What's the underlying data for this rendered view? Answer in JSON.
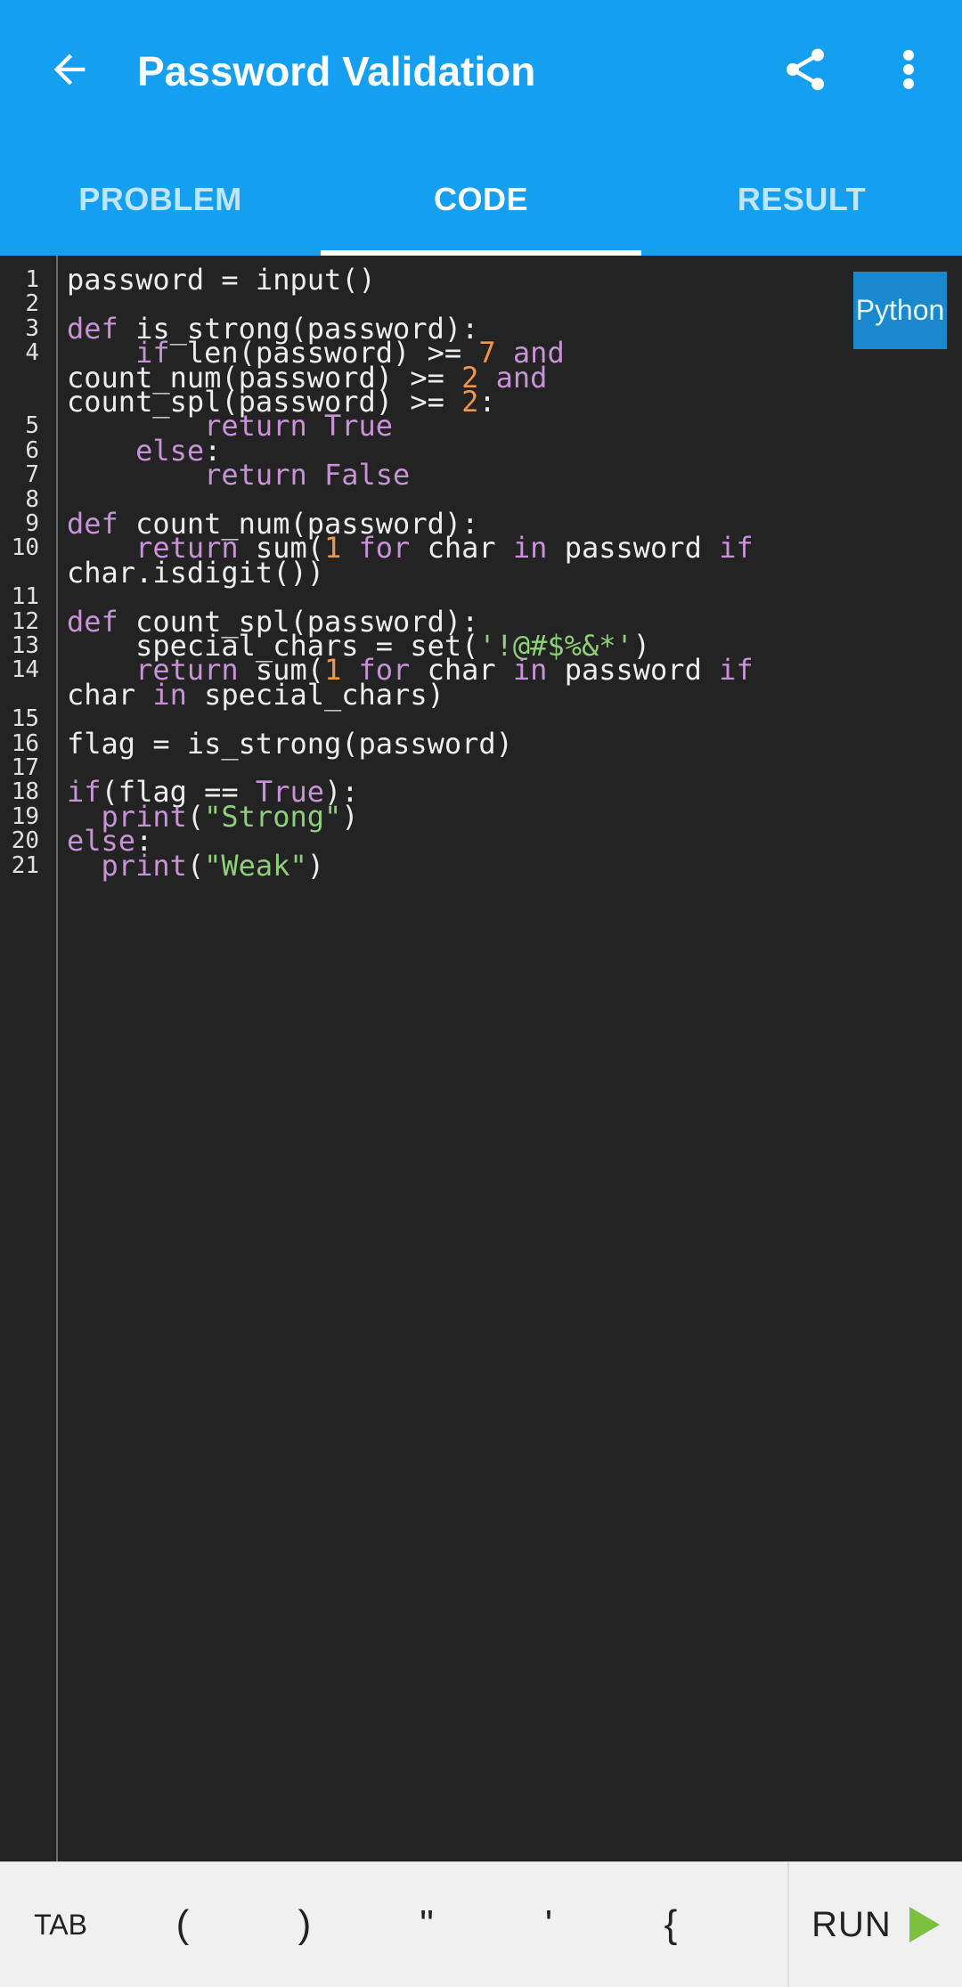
{
  "app_bar": {
    "title": "Password Validation",
    "icons": {
      "back": "back-arrow-icon",
      "share": "share-icon",
      "more": "more-vert-icon"
    },
    "color": "#159ff0"
  },
  "tabs": [
    {
      "label": "PROBLEM",
      "active": false
    },
    {
      "label": "CODE",
      "active": true
    },
    {
      "label": "RESULT",
      "active": false
    }
  ],
  "editor": {
    "language": "Python",
    "colors": {
      "keyword": "#c792d6",
      "number": "#f0964a",
      "string": "#8fce7a",
      "text": "#ededed"
    },
    "lines": [
      {
        "n": "1",
        "segments": [
          {
            "t": "password = input()"
          }
        ]
      },
      {
        "n": "2",
        "segments": [
          {
            "t": ""
          }
        ]
      },
      {
        "n": "3",
        "segments": [
          {
            "t": "def",
            "k": "kw"
          },
          {
            "t": " is_strong(password):"
          }
        ]
      },
      {
        "n": "4",
        "segments": [
          {
            "t": "    "
          },
          {
            "t": "if",
            "k": "kw"
          },
          {
            "t": " len(password) >= "
          },
          {
            "t": "7",
            "k": "num"
          },
          {
            "t": " "
          },
          {
            "t": "and",
            "k": "kw"
          }
        ]
      },
      {
        "n": "",
        "segments": [
          {
            "t": "count_num(password) >= "
          },
          {
            "t": "2",
            "k": "num"
          },
          {
            "t": " "
          },
          {
            "t": "and",
            "k": "kw"
          }
        ]
      },
      {
        "n": "",
        "segments": [
          {
            "t": "count_spl(password) >= "
          },
          {
            "t": "2",
            "k": "num"
          },
          {
            "t": ":"
          }
        ]
      },
      {
        "n": "5",
        "segments": [
          {
            "t": "        "
          },
          {
            "t": "return",
            "k": "kw"
          },
          {
            "t": " "
          },
          {
            "t": "True",
            "k": "kw"
          }
        ]
      },
      {
        "n": "6",
        "segments": [
          {
            "t": "    "
          },
          {
            "t": "else",
            "k": "kw"
          },
          {
            "t": ":"
          }
        ]
      },
      {
        "n": "7",
        "segments": [
          {
            "t": "        "
          },
          {
            "t": "return",
            "k": "kw"
          },
          {
            "t": " "
          },
          {
            "t": "False",
            "k": "kw"
          }
        ]
      },
      {
        "n": "8",
        "segments": [
          {
            "t": ""
          }
        ]
      },
      {
        "n": "9",
        "segments": [
          {
            "t": "def",
            "k": "kw"
          },
          {
            "t": " count_num(password):"
          }
        ]
      },
      {
        "n": "10",
        "segments": [
          {
            "t": "    "
          },
          {
            "t": "return",
            "k": "kw"
          },
          {
            "t": " sum("
          },
          {
            "t": "1",
            "k": "num"
          },
          {
            "t": " "
          },
          {
            "t": "for",
            "k": "kw"
          },
          {
            "t": " char "
          },
          {
            "t": "in",
            "k": "kw"
          },
          {
            "t": " password "
          },
          {
            "t": "if",
            "k": "kw"
          }
        ]
      },
      {
        "n": "",
        "segments": [
          {
            "t": "char.isdigit())"
          }
        ]
      },
      {
        "n": "11",
        "segments": [
          {
            "t": ""
          }
        ]
      },
      {
        "n": "12",
        "segments": [
          {
            "t": "def",
            "k": "kw"
          },
          {
            "t": " count_spl(password):"
          }
        ]
      },
      {
        "n": "13",
        "segments": [
          {
            "t": "    special_chars = set("
          },
          {
            "t": "'!@#$%&*'",
            "k": "str"
          },
          {
            "t": ")"
          }
        ]
      },
      {
        "n": "14",
        "segments": [
          {
            "t": "    "
          },
          {
            "t": "return",
            "k": "kw"
          },
          {
            "t": " sum("
          },
          {
            "t": "1",
            "k": "num"
          },
          {
            "t": " "
          },
          {
            "t": "for",
            "k": "kw"
          },
          {
            "t": " char "
          },
          {
            "t": "in",
            "k": "kw"
          },
          {
            "t": " password "
          },
          {
            "t": "if",
            "k": "kw"
          }
        ]
      },
      {
        "n": "",
        "segments": [
          {
            "t": "char "
          },
          {
            "t": "in",
            "k": "kw"
          },
          {
            "t": " special_chars)"
          }
        ]
      },
      {
        "n": "15",
        "segments": [
          {
            "t": ""
          }
        ]
      },
      {
        "n": "16",
        "segments": [
          {
            "t": "flag = is_strong(password)"
          }
        ]
      },
      {
        "n": "17",
        "segments": [
          {
            "t": ""
          }
        ]
      },
      {
        "n": "18",
        "segments": [
          {
            "t": "if",
            "k": "kw"
          },
          {
            "t": "(flag == "
          },
          {
            "t": "True",
            "k": "kw"
          },
          {
            "t": "):"
          }
        ]
      },
      {
        "n": "19",
        "segments": [
          {
            "t": "  "
          },
          {
            "t": "print",
            "k": "kw"
          },
          {
            "t": "("
          },
          {
            "t": "\"Strong\"",
            "k": "str"
          },
          {
            "t": ")"
          }
        ]
      },
      {
        "n": "20",
        "segments": [
          {
            "t": "else",
            "k": "kw"
          },
          {
            "t": ":"
          }
        ]
      },
      {
        "n": "21",
        "segments": [
          {
            "t": "  "
          },
          {
            "t": "print",
            "k": "kw"
          },
          {
            "t": "("
          },
          {
            "t": "\"Weak\"",
            "k": "str"
          },
          {
            "t": ")"
          }
        ]
      }
    ]
  },
  "toolbar": {
    "keys": [
      "TAB",
      "(",
      ")",
      "\"",
      "'",
      "{"
    ],
    "run_label": "RUN",
    "run_icon": "play-icon",
    "run_color": "#7cc13e"
  }
}
